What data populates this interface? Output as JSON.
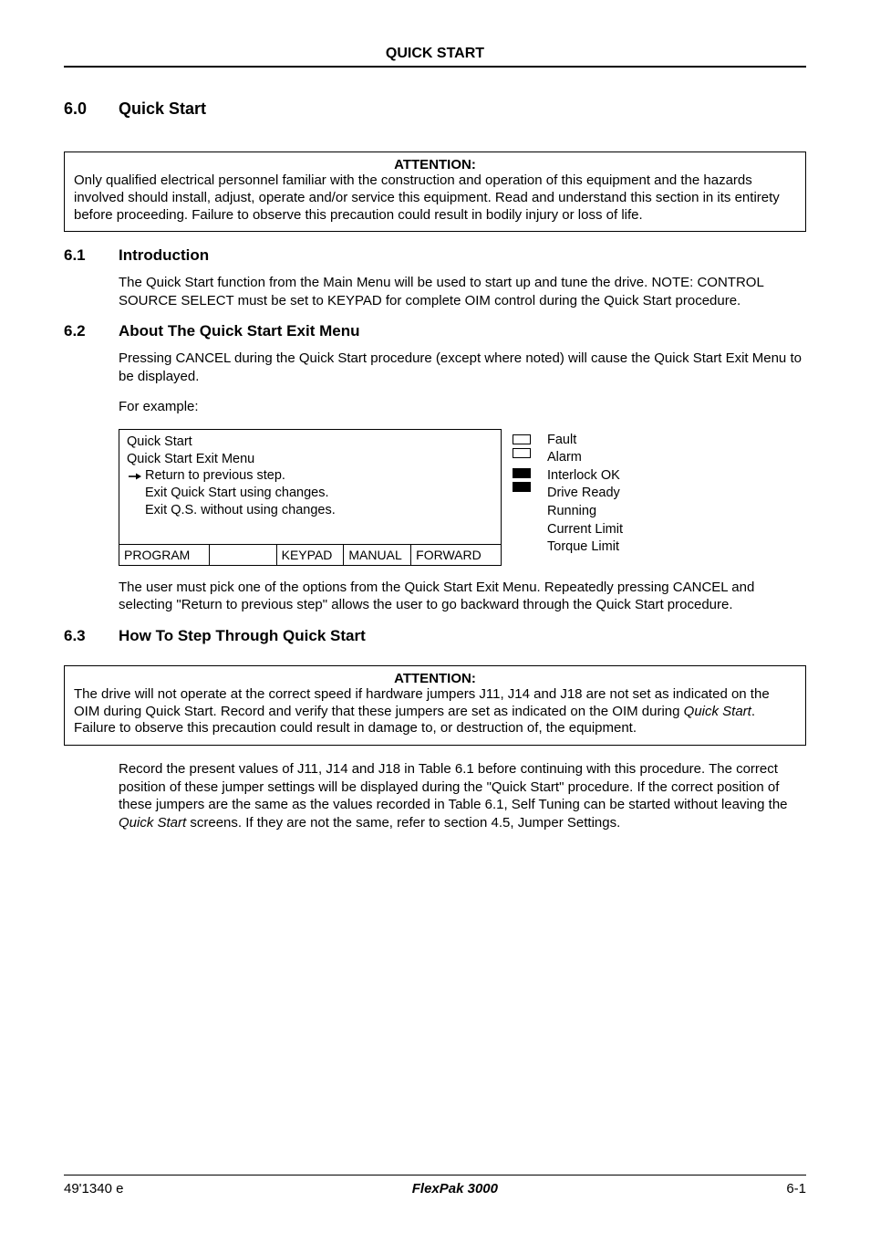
{
  "header": {
    "title": "QUICK START"
  },
  "section_main": {
    "num": "6.0",
    "title": "Quick Start"
  },
  "attention1": {
    "title": "ATTENTION:",
    "text": "Only qualified electrical personnel familiar with the construction and operation of this equipment and the hazards involved should install, adjust, operate and/or service this equipment. Read and understand this section in its entirety before proceeding. Failure to observe this precaution could result in bodily injury or loss of life."
  },
  "sub_6_1": {
    "num": "6.1",
    "title": "Introduction",
    "para": "The Quick Start function from the Main Menu will be used to start up and tune the drive. NOTE: CONTROL SOURCE SELECT must be set to KEYPAD for complete OIM control during the Quick Start procedure."
  },
  "sub_6_2": {
    "num": "6.2",
    "title": "About The Quick Start Exit Menu",
    "para1": "Pressing CANCEL during the Quick Start procedure (except where noted) will cause the Quick Start Exit Menu to be displayed.",
    "para2": "For example:",
    "para3": "The user must pick one of the options from the Quick Start Exit Menu. Repeatedly pressing CANCEL and selecting \"Return to previous step\" allows the user to go backward through the Quick Start procedure."
  },
  "oim": {
    "line1": "Quick Start",
    "line2": "Quick Start Exit Menu",
    "menu1": "Return to previous step.",
    "menu2": "Exit Quick Start using changes.",
    "menu3": "Exit Q.S. without using changes.",
    "status": {
      "c1": "PROGRAM",
      "c2": "",
      "c3": "KEYPAD",
      "c4": "MANUAL",
      "c5": "FORWARD"
    }
  },
  "leds": {
    "l1": "Fault",
    "l2": "Alarm",
    "l3": "Interlock OK",
    "l4": "Drive Ready",
    "l5": "Running",
    "l6": "Current Limit",
    "l7": "Torque Limit"
  },
  "sub_6_3": {
    "num": "6.3",
    "title": "How To Step Through Quick Start"
  },
  "attention2": {
    "title": "ATTENTION:",
    "text_before": "The drive will not operate at the correct speed if hardware jumpers J11, J14 and J18 are not set as indicated on the OIM during Quick Start. Record and verify that these jumpers are set as indicated on the OIM during ",
    "text_italic": "Quick Start",
    "text_after": ". Failure to observe this precaution could result in damage to, or destruction of, the equipment."
  },
  "para_final_before": "Record the present values of J11, J14 and J18 in Table 6.1 before continuing with this procedure. The correct position of these jumper settings will be displayed during the \"Quick Start\" procedure. If the correct position of these jumpers are the same as the values recorded in Table 6.1, Self Tuning can be started without leaving the ",
  "para_final_italic": "Quick Start",
  "para_final_after": " screens. If they are not the same, refer to section 4.5, Jumper Settings.",
  "footer": {
    "left": "49'1340 e",
    "center": "FlexPak 3000",
    "right": "6-1"
  }
}
